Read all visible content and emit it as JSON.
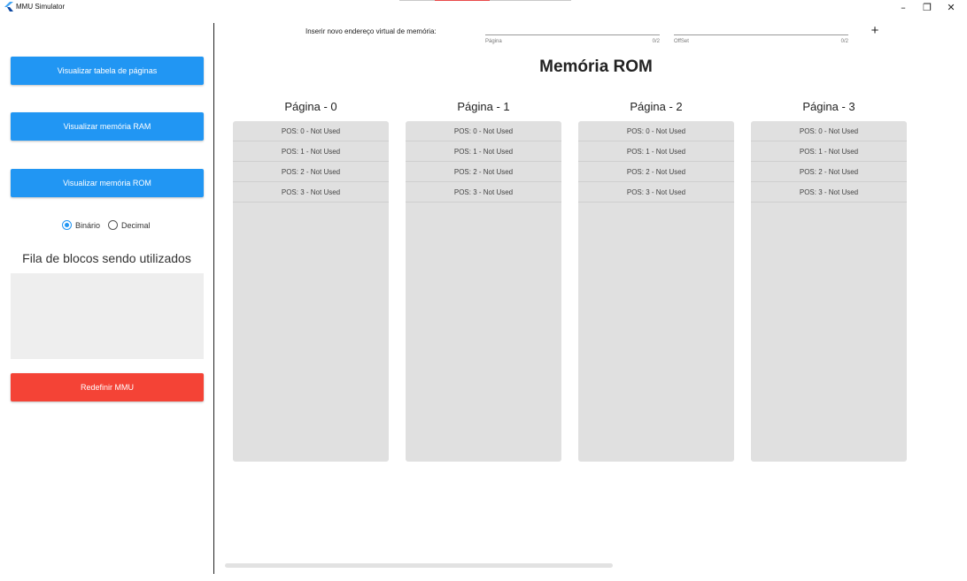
{
  "window": {
    "title": "MMU Simulator",
    "minimize_glyph": "–",
    "maximize_glyph": "❐",
    "close_glyph": "✕"
  },
  "sidebar": {
    "view_pages_button": "Visualizar tabela de páginas",
    "view_ram_button": "Visualizar memória RAM",
    "view_rom_button": "Visualizar memória ROM",
    "radio_options": [
      {
        "label": "Binário",
        "selected": true
      },
      {
        "label": "Decimal",
        "selected": false
      }
    ],
    "queue_title": "Fila de blocos sendo utilizados",
    "reset_button": "Redefinir MMU"
  },
  "address_input": {
    "label": "Inserir novo endereço virtual de memória:",
    "page_field": {
      "hint": "Página",
      "counter": "0/2"
    },
    "offset_field": {
      "hint": "OffSet",
      "counter": "0/2"
    },
    "add_glyph": "+"
  },
  "main": {
    "title": "Memória ROM",
    "pages": [
      {
        "title": "Página - 0",
        "positions": [
          "POS: 0 - Not Used",
          "POS: 1 - Not Used",
          "POS: 2 - Not Used",
          "POS: 3 - Not Used"
        ]
      },
      {
        "title": "Página - 1",
        "positions": [
          "POS: 0 - Not Used",
          "POS: 1 - Not Used",
          "POS: 2 - Not Used",
          "POS: 3 - Not Used"
        ]
      },
      {
        "title": "Página - 2",
        "positions": [
          "POS: 0 - Not Used",
          "POS: 1 - Not Used",
          "POS: 2 - Not Used",
          "POS: 3 - Not Used"
        ]
      },
      {
        "title": "Página - 3",
        "positions": [
          "POS: 0 - Not Used",
          "POS: 1 - Not Used",
          "POS: 2 - Not Used",
          "POS: 3 - Not Used"
        ]
      }
    ]
  },
  "colors": {
    "primary_button": "#2196f3",
    "danger_button": "#f44336",
    "page_box": "#e0e0e0",
    "queue_box": "#eeeeee"
  }
}
